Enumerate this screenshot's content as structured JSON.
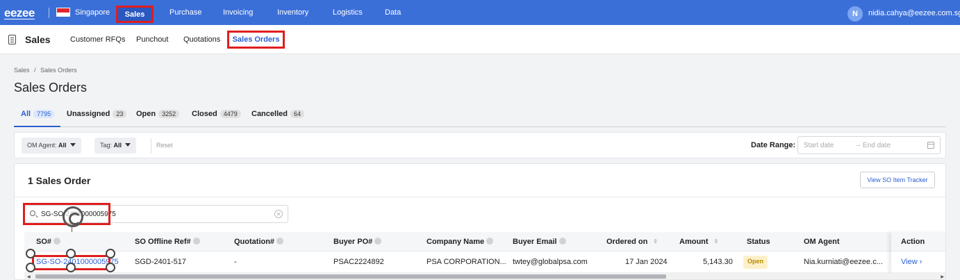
{
  "topnav": {
    "logo": "eezee",
    "country": "Singapore",
    "items": [
      "Sales",
      "Purchase",
      "Invoicing",
      "Inventory",
      "Logistics",
      "Data"
    ],
    "avatar_initial": "N",
    "user_email": "nidia.cahya@eezee.com.sg"
  },
  "subnav": {
    "title": "Sales",
    "items": [
      "Customer RFQs",
      "Punchout",
      "Quotations",
      "Sales Orders"
    ]
  },
  "breadcrumb": {
    "root": "Sales",
    "separator": "/",
    "current": "Sales Orders"
  },
  "page_title": "Sales Orders",
  "tabs": [
    {
      "label": "All",
      "count": "7795"
    },
    {
      "label": "Unassigned",
      "count": "23"
    },
    {
      "label": "Open",
      "count": "3252"
    },
    {
      "label": "Closed",
      "count": "4479"
    },
    {
      "label": "Cancelled",
      "count": "64"
    }
  ],
  "filters": {
    "om_agent_label": "OM Agent:",
    "om_agent_value": "All",
    "tag_label": "Tag:",
    "tag_value": "All",
    "reset": "Reset",
    "date_range_label": "Date Range:",
    "start_placeholder": "Start date",
    "end_placeholder": "End date",
    "date_separator": "→"
  },
  "results": {
    "title": "1 Sales Order",
    "tracker_button": "View SO Item Tracker",
    "search_value": "SG-SO-2401000005975"
  },
  "table": {
    "headers": [
      "SO#",
      "SO Offline Ref#",
      "Quotation#",
      "Buyer PO#",
      "Company Name",
      "Buyer Email",
      "Ordered on",
      "Amount",
      "Status",
      "OM Agent",
      "Action"
    ],
    "row": {
      "so": "SG-SO-2401000005975",
      "offline_ref": "SGD-2401-517",
      "quotation": "-",
      "buyer_po": "PSAC2224892",
      "company": "PSA CORPORATION...",
      "email": "twtey@globalpsa.com",
      "ordered_on": "17 Jan 2024",
      "amount": "5,143.30",
      "status": "Open",
      "om_agent": "Nia.kurniati@eezee.c...",
      "action": "View ›"
    }
  },
  "colors": {
    "nav_blue": "#3b6fd8",
    "accent_blue": "#2a5fd0",
    "highlight_red": "#e01d1d",
    "status_open_bg": "#fdf0c9"
  }
}
